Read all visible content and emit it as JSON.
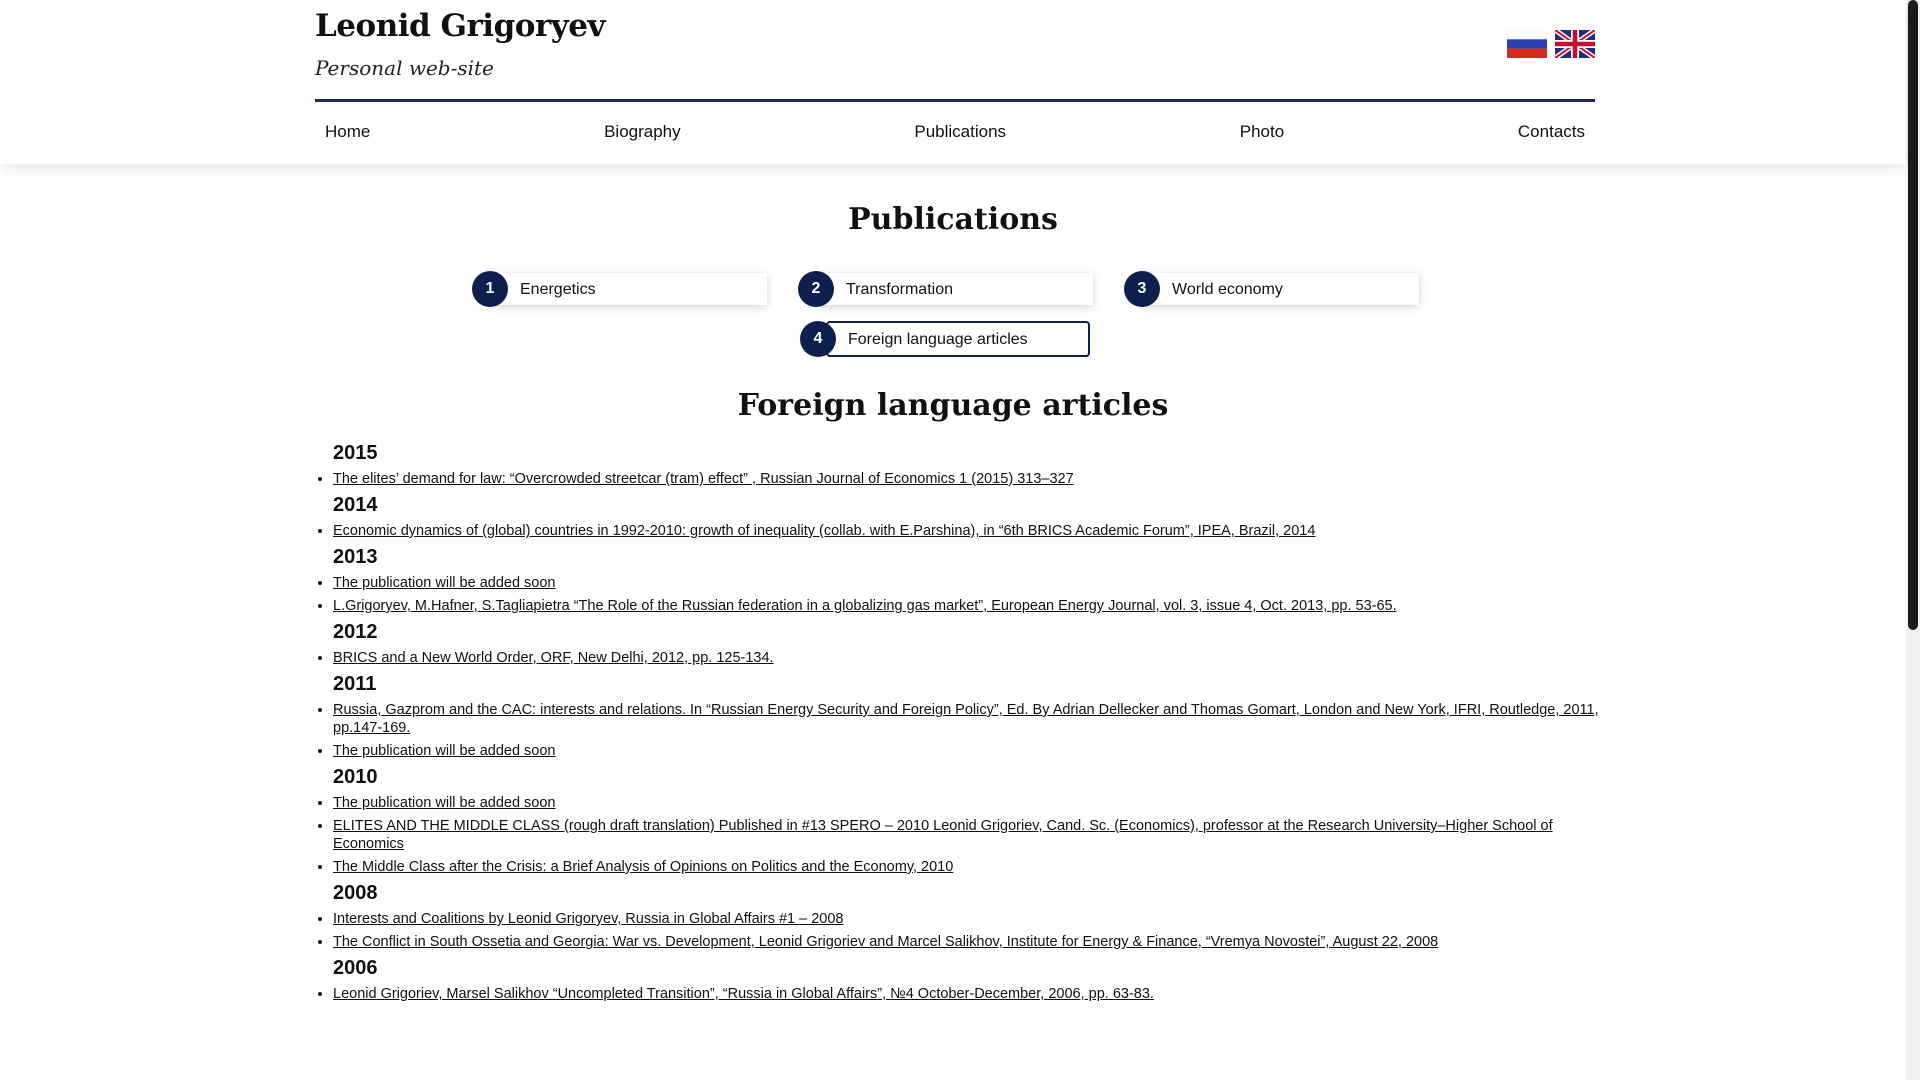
{
  "site": {
    "title": "Leonid Grigoryev",
    "subtitle": "Personal web-site",
    "flags": [
      {
        "name": "russian-flag-icon",
        "colors": [
          "#ffffff",
          "#2a3fb0",
          "#d52b1e"
        ]
      },
      {
        "name": "uk-flag-icon",
        "colors": [
          "#1f2f7a",
          "#ffffff",
          "#c8102e"
        ]
      }
    ]
  },
  "nav": {
    "items": [
      {
        "label": "Home"
      },
      {
        "label": "Biography"
      },
      {
        "label": "Publications"
      },
      {
        "label": "Photo"
      },
      {
        "label": "Contacts"
      }
    ]
  },
  "page": {
    "title": "Publications",
    "section_title": "Foreign language articles"
  },
  "categories": [
    {
      "num": "1",
      "label": "Energetics"
    },
    {
      "num": "2",
      "label": "Transformation"
    },
    {
      "num": "3",
      "label": "World economy"
    },
    {
      "num": "4",
      "label": "Foreign language articles",
      "active": true
    }
  ],
  "publications": [
    {
      "year": "2015",
      "items": [
        "The elites’ demand for law: “Overcrowded streetcar (tram) effect” , Russian Journal of Economics 1 (2015) 313–327"
      ]
    },
    {
      "year": "2014",
      "items": [
        "Economic dynamics of (global) countries in 1992-2010: growth of inequality (collab. with E.Parshina), in “6th BRICS Academic Forum”, IPEA, Brazil, 2014"
      ]
    },
    {
      "year": "2013",
      "items": [
        "The publication will be added soon",
        "L.Grigoryev, M.Hafner, S.Tagliapietra “The Role of the Russian federation in a globalizing gas market”, European Energy Journal, vol. 3, issue 4, Oct. 2013, pp. 53-65."
      ]
    },
    {
      "year": "2012",
      "items": [
        "BRICS and a New World Order, ORF, New Delhi, 2012, pp. 125-134."
      ]
    },
    {
      "year": "2011",
      "items": [
        "Russia, Gazprom and the CAC: interests and relations. In “Russian Energy Security and Foreign Policy”, Ed. By Adrian Dellecker and Thomas Gomart, London and New York, IFRI, Routledge, 2011, pp.147-169.",
        "The publication will be added soon"
      ]
    },
    {
      "year": "2010",
      "items": [
        "The publication will be added soon",
        "ELITES AND THE MIDDLE CLASS (rough draft translation) Published in #13 SPERO – 2010 Leonid Grigoriev, Cand. Sc. (Economics), professor at the Research University–Higher School of Economics",
        "The Middle Class after the Crisis: a Brief Analysis of Opinions on Politics and the Economy, 2010"
      ]
    },
    {
      "year": "2008",
      "items": [
        "Interests and Coalitions by Leonid Grigoryev, Russia in Global Affairs #1 – 2008",
        "The Conflict in South Ossetia and Georgia: War vs. Development, Leonid Grigoriev and Marcel Salikhov, Institute for Energy & Finance, “Vremya Novostei”, August 22, 2008"
      ]
    },
    {
      "year": "2006",
      "items": [
        "Leonid Grigoriev, Marsel Salikhov “Uncompleted Transition”, “Russia in Global Affairs”, №4 October-December, 2006, pp. 63-83."
      ]
    }
  ]
}
